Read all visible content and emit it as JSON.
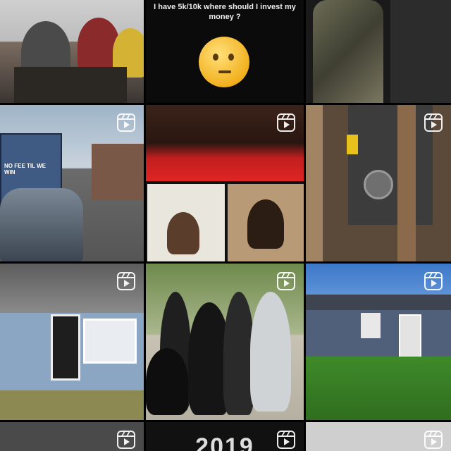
{
  "grid": {
    "tiles": [
      {
        "name": "classroom-photo",
        "reel": false
      },
      {
        "name": "question-post",
        "reel": false,
        "caption": "I have 5k/10k where should I invest my money ?"
      },
      {
        "name": "camo-man-photo",
        "reel": false
      },
      {
        "name": "bus-street-video",
        "reel": true,
        "bus_sign": "NO FEE TIL WE WIN"
      },
      {
        "name": "selfie-video",
        "reel": true
      },
      {
        "name": "hvac-video",
        "reel": true
      },
      {
        "name": "blue-house-video",
        "reel": true
      },
      {
        "name": "group-photo-video",
        "reel": true
      },
      {
        "name": "house-lawn-video",
        "reel": true
      },
      {
        "name": "bottom-left-video",
        "reel": true
      },
      {
        "name": "year-video",
        "reel": true,
        "text": "2019"
      },
      {
        "name": "bottom-right-video",
        "reel": true
      }
    ]
  }
}
